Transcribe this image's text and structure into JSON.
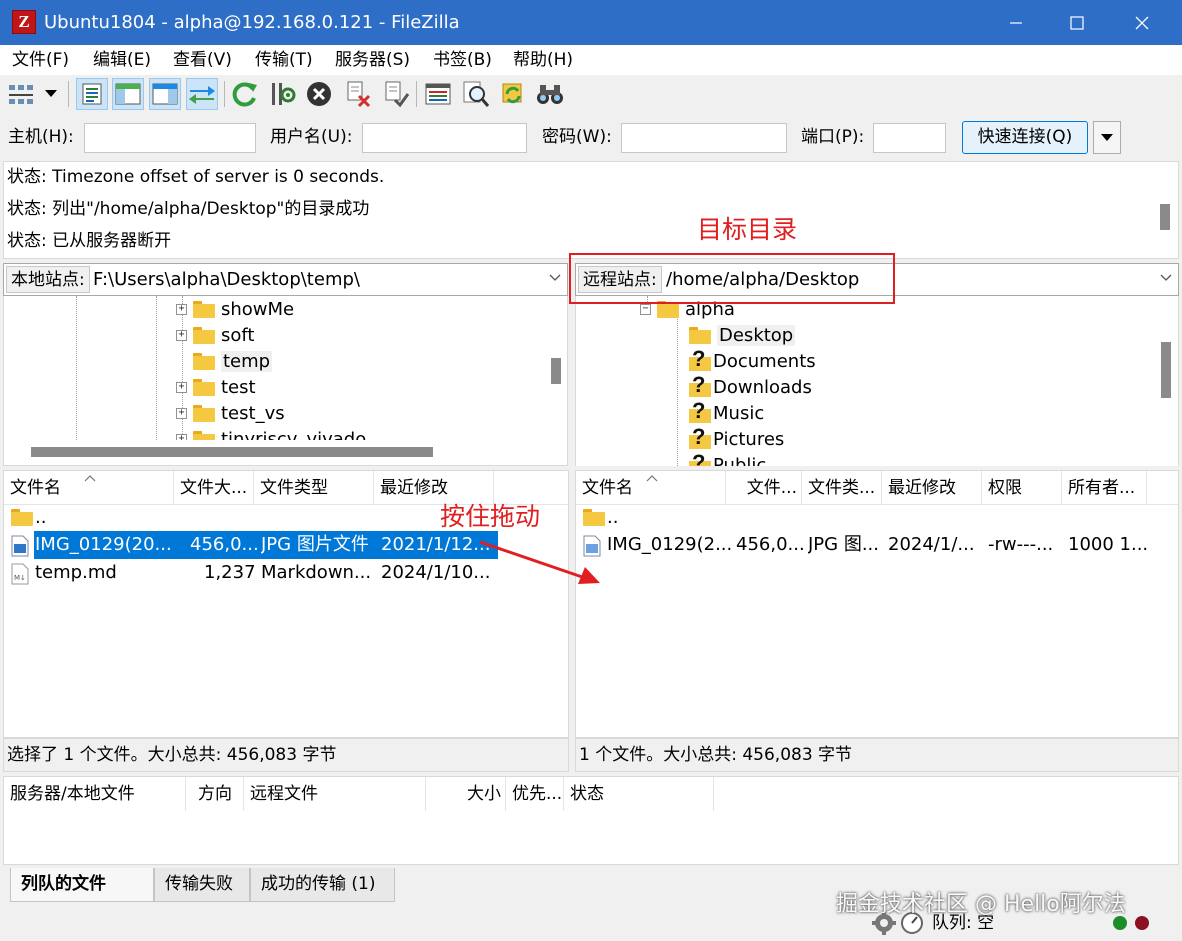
{
  "window": {
    "title": "Ubuntu1804 - alpha@192.168.0.121 - FileZilla",
    "app_icon_letter": "Z",
    "min_glyph": "—",
    "max_glyph": "☐",
    "close_glyph": "✕"
  },
  "menu": [
    "文件(F)",
    "编辑(E)",
    "查看(V)",
    "传输(T)",
    "服务器(S)",
    "书签(B)",
    "帮助(H)"
  ],
  "quickconnect": {
    "host_label": "主机(H):",
    "user_label": "用户名(U):",
    "pass_label": "密码(W):",
    "port_label": "端口(P):",
    "host_value": "",
    "user_value": "",
    "pass_value": "",
    "port_value": "",
    "connect_label": "快速连接(Q)"
  },
  "log": [
    "状态: Timezone offset of server is 0 seconds.",
    "状态: 列出\"/home/alpha/Desktop\"的目录成功",
    "状态: 已从服务器断开"
  ],
  "local": {
    "site_label": "本地站点:",
    "path": "F:\\Users\\alpha\\Desktop\\temp\\",
    "tree": [
      "showMe",
      "soft",
      "temp",
      "test",
      "test_vs",
      "tinyriscv_vivado"
    ],
    "columns": [
      "文件名",
      "文件大...",
      "文件类型",
      "最近修改"
    ],
    "files": [
      {
        "name": "..",
        "size": "",
        "type": "",
        "modified": ""
      },
      {
        "name": "IMG_0129(20...",
        "size": "456,0...",
        "type": "JPG 图片文件",
        "modified": "2021/1/12..."
      },
      {
        "name": "temp.md",
        "size": "1,237",
        "type": "Markdown...",
        "modified": "2024/1/10..."
      }
    ],
    "status": "选择了 1 个文件。大小总共: 456,083 字节"
  },
  "remote": {
    "site_label": "远程站点:",
    "path": "/home/alpha/Desktop",
    "tree": [
      "alpha",
      "Desktop",
      "Documents",
      "Downloads",
      "Music",
      "Pictures",
      "Public"
    ],
    "columns": [
      "文件名",
      "文件...",
      "文件类...",
      "最近修改",
      "权限",
      "所有者..."
    ],
    "files": [
      {
        "name": "..",
        "size": "",
        "type": "",
        "modified": "",
        "perm": "",
        "owner": ""
      },
      {
        "name": "IMG_0129(2...",
        "size": "456,0...",
        "type": "JPG 图...",
        "modified": "2024/1/...",
        "perm": "-rw---...",
        "owner": "1000 1..."
      }
    ],
    "status": "1 个文件。大小总共: 456,083 字节"
  },
  "queue": {
    "columns": [
      "服务器/本地文件",
      "方向",
      "远程文件",
      "大小",
      "优先...",
      "状态"
    ],
    "tabs": [
      "列队的文件",
      "传输失败",
      "成功的传输 (1)"
    ],
    "status": "队列: 空"
  },
  "annotations": {
    "target_dir": "目标目录",
    "drag_hint": "按住拖动"
  },
  "watermark": "掘金技术社区 @ Hello阿尔法",
  "colors": {
    "titlebar": "#2e6ec7",
    "selection": "#0078d7",
    "annotation": "#e02020"
  }
}
